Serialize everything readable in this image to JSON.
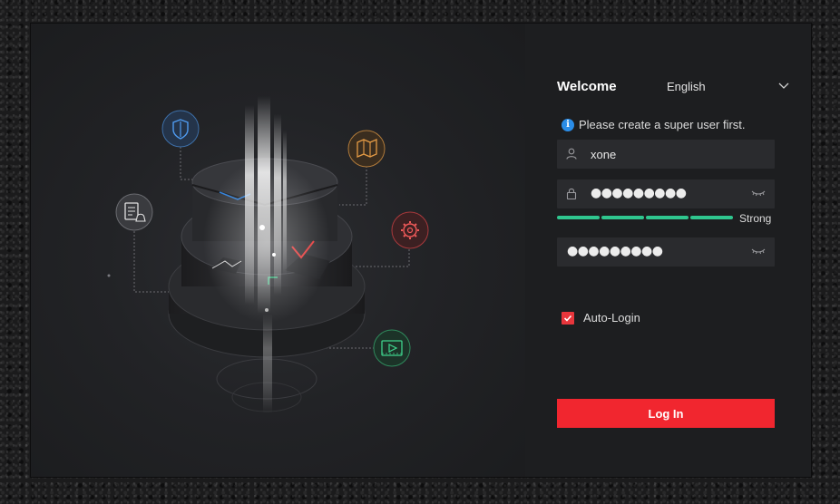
{
  "window": {
    "minimize_icon": "minimize-icon",
    "close_icon": "close-icon"
  },
  "form": {
    "welcome": "Welcome",
    "language": "English",
    "hint": "Please create a super user first.",
    "username": "xone",
    "password_mask": "●●●●●●●●●",
    "confirm_mask": "●●●●●●●●●",
    "strength_label": "Strong",
    "strength_level": 4,
    "strength_max": 4,
    "auto_login_label": "Auto-Login",
    "auto_login_checked": true,
    "login_label": "Log In"
  },
  "colors": {
    "accent_red": "#f1262f",
    "strength_green": "#2fc68e",
    "info_blue": "#2a8de8"
  }
}
